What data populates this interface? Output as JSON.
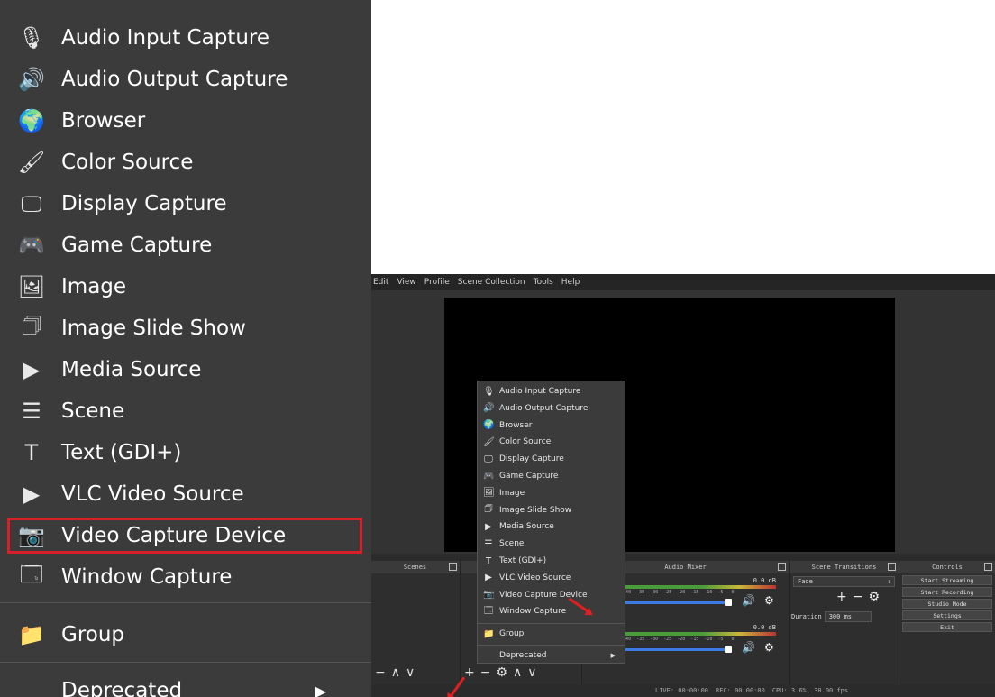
{
  "zoom_menu": {
    "items": [
      {
        "label": "Audio Input Capture",
        "icon": "microphone-icon",
        "glyph": "🎙"
      },
      {
        "label": "Audio Output Capture",
        "icon": "speaker-icon",
        "glyph": "🔊"
      },
      {
        "label": "Browser",
        "icon": "globe-icon",
        "glyph": "🌍"
      },
      {
        "label": "Color Source",
        "icon": "paintbrush-icon",
        "glyph": "🖌"
      },
      {
        "label": "Display Capture",
        "icon": "monitor-icon",
        "glyph": "🖵"
      },
      {
        "label": "Game Capture",
        "icon": "gamepad-icon",
        "glyph": "🎮"
      },
      {
        "label": "Image",
        "icon": "image-icon",
        "glyph": "🖼"
      },
      {
        "label": "Image Slide Show",
        "icon": "slideshow-icon",
        "glyph": "🗇"
      },
      {
        "label": "Media Source",
        "icon": "play-icon",
        "glyph": "▶"
      },
      {
        "label": "Scene",
        "icon": "list-icon",
        "glyph": "☰"
      },
      {
        "label": "Text (GDI+)",
        "icon": "text-icon",
        "glyph": "T"
      },
      {
        "label": "VLC Video Source",
        "icon": "play-icon",
        "glyph": "▶"
      },
      {
        "label": "Video Capture Device",
        "icon": "camera-icon",
        "glyph": "📷"
      },
      {
        "label": "Window Capture",
        "icon": "window-icon",
        "glyph": "🗔"
      }
    ],
    "group_label": "Group",
    "deprecated_label": "Deprecated"
  },
  "obs": {
    "menubar": [
      "Edit",
      "View",
      "Profile",
      "Scene Collection",
      "Tools",
      "Help"
    ],
    "docks": {
      "scenes": "Scenes",
      "mixer": "Audio Mixer",
      "transitions": "Scene Transitions",
      "controls": "Controls"
    },
    "mixer": {
      "db1": "0.0 dB",
      "db2": "0.0 dB",
      "scale": "-45  -40  -35  -30  -25  -20  -15  -10  -5   0"
    },
    "transitions": {
      "type": "Fade",
      "duration_label": "Duration",
      "duration_value": "300 ms"
    },
    "controls": [
      "Start Streaming",
      "Start Recording",
      "Studio Mode",
      "Settings",
      "Exit"
    ],
    "status": {
      "live": "LIVE: 00:00:00",
      "rec": "REC: 00:00:00",
      "cpu": "CPU: 3.6%, 30.00 fps"
    },
    "popup": {
      "items": [
        "Audio Input Capture",
        "Audio Output Capture",
        "Browser",
        "Color Source",
        "Display Capture",
        "Game Capture",
        "Image",
        "Image Slide Show",
        "Media Source",
        "Scene",
        "Text (GDI+)",
        "VLC Video Source",
        "Video Capture Device",
        "Window Capture"
      ],
      "icons": [
        "🎙",
        "🔊",
        "🌍",
        "🖌",
        "🖵",
        "🎮",
        "🖼",
        "🗇",
        "▶",
        "☰",
        "T",
        "▶",
        "📷",
        "🗔"
      ],
      "group": "Group",
      "deprecated": "Deprecated"
    }
  }
}
